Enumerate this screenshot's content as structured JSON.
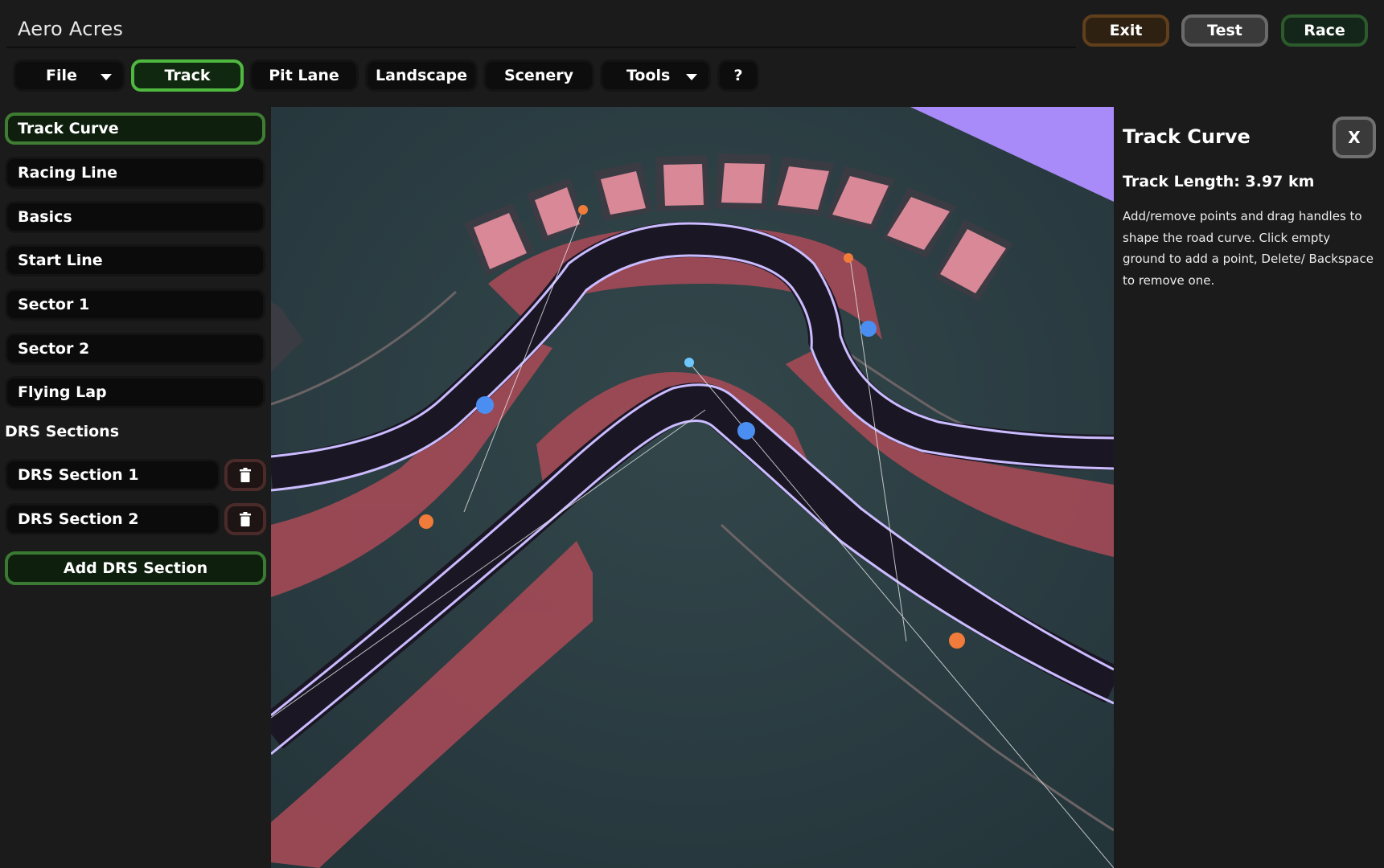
{
  "header": {
    "title": "Aero Acres",
    "exit_label": "Exit",
    "test_label": "Test",
    "race_label": "Race"
  },
  "tabs": [
    {
      "label": "File",
      "has_dropdown": true
    },
    {
      "label": "Track",
      "active": true
    },
    {
      "label": "Pit Lane"
    },
    {
      "label": "Landscape"
    },
    {
      "label": "Scenery"
    },
    {
      "label": "Tools",
      "has_dropdown": true
    },
    {
      "label": "?"
    }
  ],
  "sidebar": {
    "items": [
      {
        "label": "Track Curve",
        "active": true
      },
      {
        "label": "Racing Line"
      },
      {
        "label": "Basics"
      },
      {
        "label": "Start Line"
      },
      {
        "label": "Sector 1"
      },
      {
        "label": "Sector 2"
      },
      {
        "label": "Flying Lap"
      }
    ],
    "drs_heading": "DRS Sections",
    "drs_sections": [
      {
        "label": "DRS Section 1"
      },
      {
        "label": "DRS Section 2"
      }
    ],
    "add_drs_label": "Add DRS Section"
  },
  "panel": {
    "title": "Track Curve",
    "close_label": "X",
    "track_length": "Track Length: 3.97 km",
    "help": "Add/remove points and drag handles to shape the road curve. Click empty ground to add a point, Delete/ Backspace to remove one."
  },
  "colors": {
    "active_green": "#4fb83f",
    "curve_point": "#4a8ef2",
    "handle_point": "#f07b3a",
    "track_line": "#cbbcff",
    "kerb": "#b0505a",
    "ground": "#2b3c40"
  }
}
